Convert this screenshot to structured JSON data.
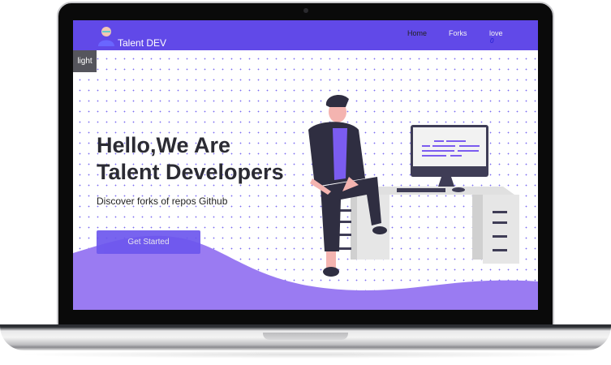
{
  "nav": {
    "brand": "Talent DEV",
    "links": [
      {
        "label": "Home"
      },
      {
        "label": "Forks"
      },
      {
        "label": "love"
      }
    ],
    "love_count": "0"
  },
  "theme_toggle": "light",
  "hero": {
    "title_line1": "Hello,We Are",
    "title_line2": "Talent Developers",
    "subtitle": "Discover forks of repos Github",
    "cta": "Get Started"
  },
  "colors": {
    "primary": "#6149e8",
    "wave": "#9a7bf2",
    "dark": "#2f2e41"
  }
}
